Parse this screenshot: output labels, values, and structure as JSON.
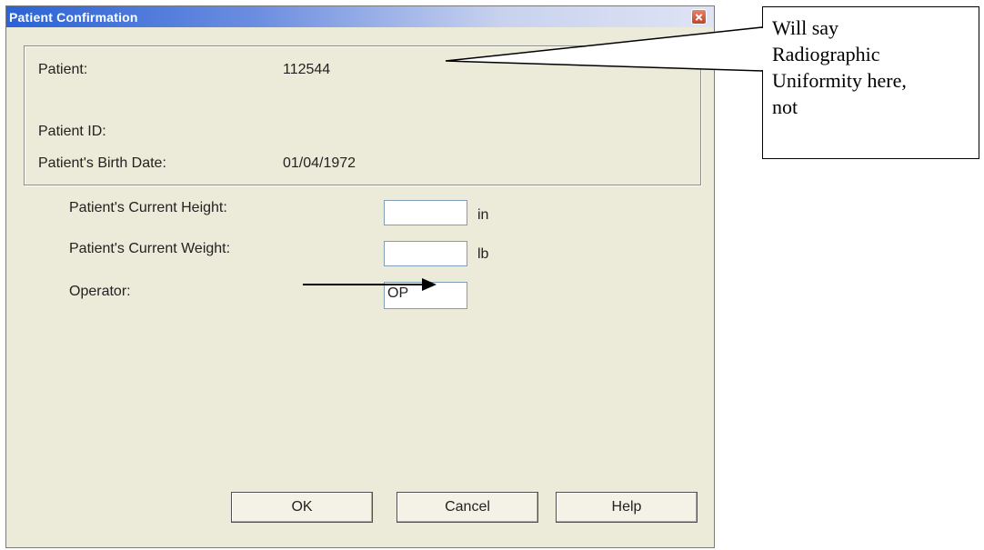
{
  "window": {
    "title": "Patient Confirmation"
  },
  "patient_info": {
    "patient_label": "Patient:",
    "patient_value": "112544",
    "patient_id_label": "Patient ID:",
    "patient_id_value": "",
    "birth_date_label": "Patient's Birth Date:",
    "birth_date_value": "01/04/1972"
  },
  "form": {
    "height_label": "Patient's Current Height:",
    "height_value": "",
    "height_unit": "in",
    "weight_label": "Patient's Current Weight:",
    "weight_value": "",
    "weight_unit": "lb",
    "operator_label": "Operator:",
    "operator_value": "OP"
  },
  "buttons": {
    "ok": "OK",
    "cancel": "Cancel",
    "help": "Help"
  },
  "annotation": {
    "callout_text": "Will say Radiographic Uniformity here, not"
  },
  "colors": {
    "titlebar_start": "#2a63d6",
    "dialog_bg": "#ecead8",
    "close_button": "#c4442a"
  }
}
